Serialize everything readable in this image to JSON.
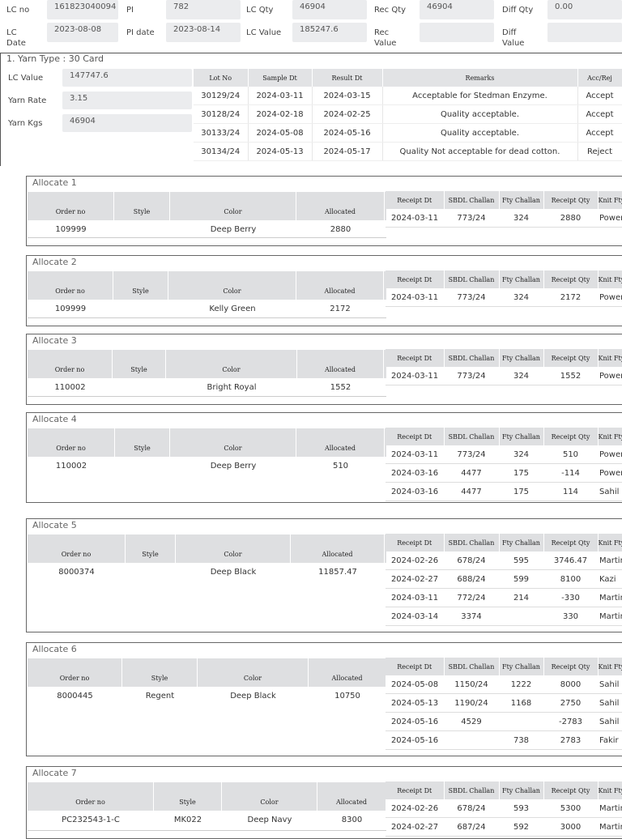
{
  "header": {
    "lc_no_label": "LC no",
    "lc_no": "161823040094",
    "pi_label": "PI",
    "pi": "782",
    "lc_qty_label": "LC Qty",
    "lc_qty": "46904",
    "rec_qty_label": "Rec Qty",
    "rec_qty": "46904",
    "diff_qty_label": "Diff Qty",
    "diff_qty": "0.00",
    "lc_date_label_1": "LC",
    "lc_date_label_2": "Date",
    "lc_date": "2023-08-08",
    "pi_date_label": "PI date",
    "pi_date": "2023-08-14",
    "lc_value_label": "LC Value",
    "lc_value": "185247.6",
    "rec_value_label_1": "Rec",
    "rec_value_label_2": "Value",
    "rec_value": "",
    "diff_value_label_1": "Diff",
    "diff_value_label_2": "Value",
    "diff_value": ""
  },
  "yarn": {
    "title": "1. Yarn Type : 30 Card",
    "lc_value_label": "LC Value",
    "lc_value": "147747.6",
    "rate_label": "Yarn Rate",
    "rate": "3.15",
    "kgs_label": "Yarn Kgs",
    "kgs": "46904",
    "qc_columns": [
      "Lot No",
      "Sample Dt",
      "Result Dt",
      "Remarks",
      "Acc/Rej"
    ],
    "qc_rows": [
      [
        "30129/24",
        "2024-03-11",
        "2024-03-15",
        "Acceptable for Stedman Enzyme.",
        "Accept"
      ],
      [
        "30128/24",
        "2024-02-18",
        "2024-02-25",
        "Quality acceptable.",
        "Accept"
      ],
      [
        "30133/24",
        "2024-05-08",
        "2024-05-16",
        "Quality acceptable.",
        "Accept"
      ],
      [
        "30134/24",
        "2024-05-13",
        "2024-05-17",
        "Quality Not acceptable for dead cotton.",
        "Reject"
      ]
    ]
  },
  "order_columns": [
    "Order no",
    "Style",
    "Color",
    "Allocated"
  ],
  "receipt_columns": [
    "Receipt Dt",
    "SBDL Challan",
    "Fty Challan",
    "Receipt Qty",
    "Knit Fty"
  ],
  "allocations": [
    {
      "title": "Allocate 1",
      "order": [
        "109999",
        "",
        "Deep Berry",
        "2880"
      ],
      "receipts": [
        [
          "2024-03-11",
          "773/24",
          "324",
          "2880",
          "Power"
        ]
      ]
    },
    {
      "title": "Allocate 2",
      "order": [
        "109999",
        "",
        "Kelly Green",
        "2172"
      ],
      "receipts": [
        [
          "2024-03-11",
          "773/24",
          "324",
          "2172",
          "Power"
        ]
      ]
    },
    {
      "title": "Allocate 3",
      "order": [
        "110002",
        "",
        "Bright Royal",
        "1552"
      ],
      "receipts": [
        [
          "2024-03-11",
          "773/24",
          "324",
          "1552",
          "Power"
        ]
      ]
    },
    {
      "title": "Allocate 4",
      "order": [
        "110002",
        "",
        "Deep Berry",
        "510"
      ],
      "receipts": [
        [
          "2024-03-11",
          "773/24",
          "324",
          "510",
          "Power"
        ],
        [
          "2024-03-16",
          "4477",
          "175",
          "-114",
          "Power"
        ],
        [
          "2024-03-16",
          "4477",
          "175",
          "114",
          "Sahil"
        ]
      ]
    },
    {
      "title": "Allocate 5",
      "order": [
        "8000374",
        "",
        "Deep Black",
        "11857.47"
      ],
      "receipts": [
        [
          "2024-02-26",
          "678/24",
          "595",
          "3746.47",
          "Martin"
        ],
        [
          "2024-02-27",
          "688/24",
          "599",
          "8100",
          "Kazi"
        ],
        [
          "2024-03-11",
          "772/24",
          "214",
          "-330",
          "Martin"
        ],
        [
          "2024-03-14",
          "3374",
          "",
          "330",
          "Martin"
        ]
      ]
    },
    {
      "title": "Allocate 6",
      "order": [
        "8000445",
        "Regent",
        "Deep Black",
        "10750"
      ],
      "receipts": [
        [
          "2024-05-08",
          "1150/24",
          "1222",
          "8000",
          "Sahil"
        ],
        [
          "2024-05-13",
          "1190/24",
          "1168",
          "2750",
          "Sahil"
        ],
        [
          "2024-05-16",
          "4529",
          "",
          "-2783",
          "Sahil"
        ],
        [
          "2024-05-16",
          "",
          "738",
          "2783",
          "Fakir"
        ]
      ]
    },
    {
      "title": "Allocate 7",
      "order": [
        "PC232543-1-C",
        "MK022",
        "Deep Navy",
        "8300"
      ],
      "receipts": [
        [
          "2024-02-26",
          "678/24",
          "593",
          "5300",
          "Martin"
        ],
        [
          "2024-02-27",
          "687/24",
          "592",
          "3000",
          "Martin"
        ]
      ]
    }
  ]
}
